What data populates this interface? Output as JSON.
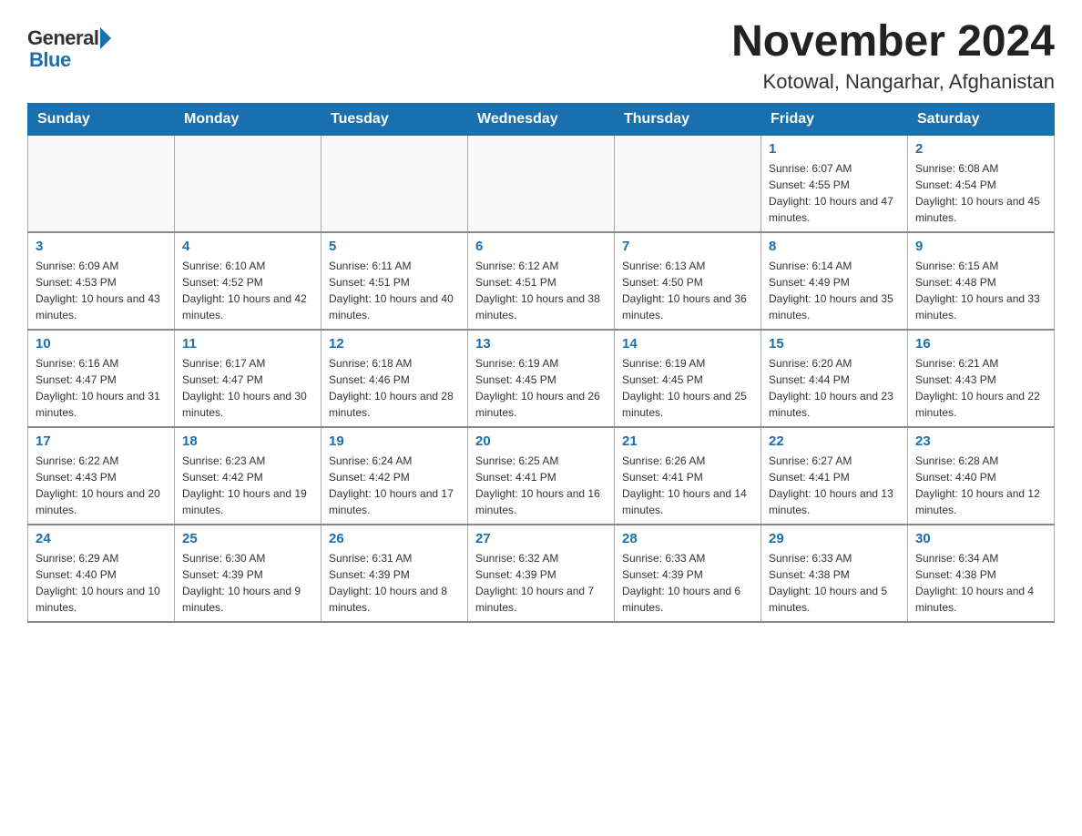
{
  "header": {
    "logo_general": "General",
    "logo_blue": "Blue",
    "title": "November 2024",
    "subtitle": "Kotowal, Nangarhar, Afghanistan"
  },
  "weekdays": [
    "Sunday",
    "Monday",
    "Tuesday",
    "Wednesday",
    "Thursday",
    "Friday",
    "Saturday"
  ],
  "weeks": [
    [
      {
        "day": "",
        "info": ""
      },
      {
        "day": "",
        "info": ""
      },
      {
        "day": "",
        "info": ""
      },
      {
        "day": "",
        "info": ""
      },
      {
        "day": "",
        "info": ""
      },
      {
        "day": "1",
        "info": "Sunrise: 6:07 AM\nSunset: 4:55 PM\nDaylight: 10 hours and 47 minutes."
      },
      {
        "day": "2",
        "info": "Sunrise: 6:08 AM\nSunset: 4:54 PM\nDaylight: 10 hours and 45 minutes."
      }
    ],
    [
      {
        "day": "3",
        "info": "Sunrise: 6:09 AM\nSunset: 4:53 PM\nDaylight: 10 hours and 43 minutes."
      },
      {
        "day": "4",
        "info": "Sunrise: 6:10 AM\nSunset: 4:52 PM\nDaylight: 10 hours and 42 minutes."
      },
      {
        "day": "5",
        "info": "Sunrise: 6:11 AM\nSunset: 4:51 PM\nDaylight: 10 hours and 40 minutes."
      },
      {
        "day": "6",
        "info": "Sunrise: 6:12 AM\nSunset: 4:51 PM\nDaylight: 10 hours and 38 minutes."
      },
      {
        "day": "7",
        "info": "Sunrise: 6:13 AM\nSunset: 4:50 PM\nDaylight: 10 hours and 36 minutes."
      },
      {
        "day": "8",
        "info": "Sunrise: 6:14 AM\nSunset: 4:49 PM\nDaylight: 10 hours and 35 minutes."
      },
      {
        "day": "9",
        "info": "Sunrise: 6:15 AM\nSunset: 4:48 PM\nDaylight: 10 hours and 33 minutes."
      }
    ],
    [
      {
        "day": "10",
        "info": "Sunrise: 6:16 AM\nSunset: 4:47 PM\nDaylight: 10 hours and 31 minutes."
      },
      {
        "day": "11",
        "info": "Sunrise: 6:17 AM\nSunset: 4:47 PM\nDaylight: 10 hours and 30 minutes."
      },
      {
        "day": "12",
        "info": "Sunrise: 6:18 AM\nSunset: 4:46 PM\nDaylight: 10 hours and 28 minutes."
      },
      {
        "day": "13",
        "info": "Sunrise: 6:19 AM\nSunset: 4:45 PM\nDaylight: 10 hours and 26 minutes."
      },
      {
        "day": "14",
        "info": "Sunrise: 6:19 AM\nSunset: 4:45 PM\nDaylight: 10 hours and 25 minutes."
      },
      {
        "day": "15",
        "info": "Sunrise: 6:20 AM\nSunset: 4:44 PM\nDaylight: 10 hours and 23 minutes."
      },
      {
        "day": "16",
        "info": "Sunrise: 6:21 AM\nSunset: 4:43 PM\nDaylight: 10 hours and 22 minutes."
      }
    ],
    [
      {
        "day": "17",
        "info": "Sunrise: 6:22 AM\nSunset: 4:43 PM\nDaylight: 10 hours and 20 minutes."
      },
      {
        "day": "18",
        "info": "Sunrise: 6:23 AM\nSunset: 4:42 PM\nDaylight: 10 hours and 19 minutes."
      },
      {
        "day": "19",
        "info": "Sunrise: 6:24 AM\nSunset: 4:42 PM\nDaylight: 10 hours and 17 minutes."
      },
      {
        "day": "20",
        "info": "Sunrise: 6:25 AM\nSunset: 4:41 PM\nDaylight: 10 hours and 16 minutes."
      },
      {
        "day": "21",
        "info": "Sunrise: 6:26 AM\nSunset: 4:41 PM\nDaylight: 10 hours and 14 minutes."
      },
      {
        "day": "22",
        "info": "Sunrise: 6:27 AM\nSunset: 4:41 PM\nDaylight: 10 hours and 13 minutes."
      },
      {
        "day": "23",
        "info": "Sunrise: 6:28 AM\nSunset: 4:40 PM\nDaylight: 10 hours and 12 minutes."
      }
    ],
    [
      {
        "day": "24",
        "info": "Sunrise: 6:29 AM\nSunset: 4:40 PM\nDaylight: 10 hours and 10 minutes."
      },
      {
        "day": "25",
        "info": "Sunrise: 6:30 AM\nSunset: 4:39 PM\nDaylight: 10 hours and 9 minutes."
      },
      {
        "day": "26",
        "info": "Sunrise: 6:31 AM\nSunset: 4:39 PM\nDaylight: 10 hours and 8 minutes."
      },
      {
        "day": "27",
        "info": "Sunrise: 6:32 AM\nSunset: 4:39 PM\nDaylight: 10 hours and 7 minutes."
      },
      {
        "day": "28",
        "info": "Sunrise: 6:33 AM\nSunset: 4:39 PM\nDaylight: 10 hours and 6 minutes."
      },
      {
        "day": "29",
        "info": "Sunrise: 6:33 AM\nSunset: 4:38 PM\nDaylight: 10 hours and 5 minutes."
      },
      {
        "day": "30",
        "info": "Sunrise: 6:34 AM\nSunset: 4:38 PM\nDaylight: 10 hours and 4 minutes."
      }
    ]
  ]
}
